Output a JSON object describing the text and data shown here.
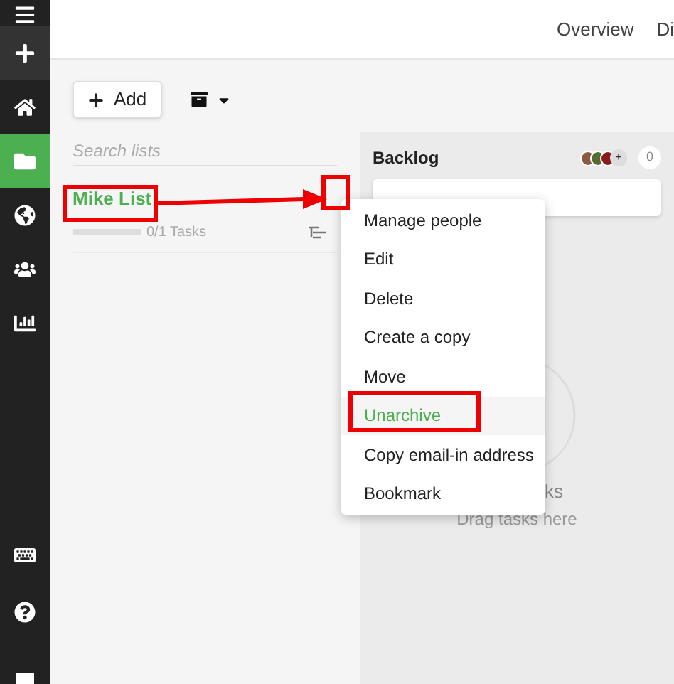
{
  "sidebar": {
    "items": [
      {
        "kind": "menu",
        "selected": false
      },
      {
        "kind": "plus",
        "selected": false
      },
      {
        "kind": "home",
        "selected": false
      },
      {
        "kind": "folder",
        "selected": true
      },
      {
        "kind": "globe",
        "selected": false
      },
      {
        "kind": "users",
        "selected": false
      },
      {
        "kind": "chart",
        "selected": false
      }
    ],
    "bottom_items": [
      {
        "kind": "keyboard"
      },
      {
        "kind": "help"
      },
      {
        "kind": "square"
      }
    ]
  },
  "header": {
    "tabs": [
      {
        "label": "Overview",
        "selected": false
      },
      {
        "label": "Di",
        "selected": false
      }
    ]
  },
  "toolbar": {
    "add_button": "Add"
  },
  "search": {
    "placeholder": "Search lists"
  },
  "lists": [
    {
      "name": "Mike List",
      "tasks": "0/1 Tasks",
      "level": 0
    }
  ],
  "column": {
    "title": "Backlog",
    "avatar_more": "+",
    "count": "0",
    "empty_title": "ks",
    "empty_hint": "Drag tasks here"
  },
  "menu": [
    {
      "label": "Manage people",
      "selected": false
    },
    {
      "label": "Edit",
      "selected": false
    },
    {
      "label": "Delete",
      "selected": false
    },
    {
      "label": "Create a copy",
      "selected": false
    },
    {
      "label": "Move",
      "selected": false
    },
    {
      "label": "Unarchive",
      "selected": true
    },
    {
      "label": "Copy email-in address",
      "selected": false
    },
    {
      "label": "Bookmark",
      "selected": false
    }
  ],
  "annotations": [
    {
      "kind": "box"
    },
    {
      "kind": "arrow"
    },
    {
      "kind": "box"
    },
    {
      "kind": "box"
    }
  ]
}
